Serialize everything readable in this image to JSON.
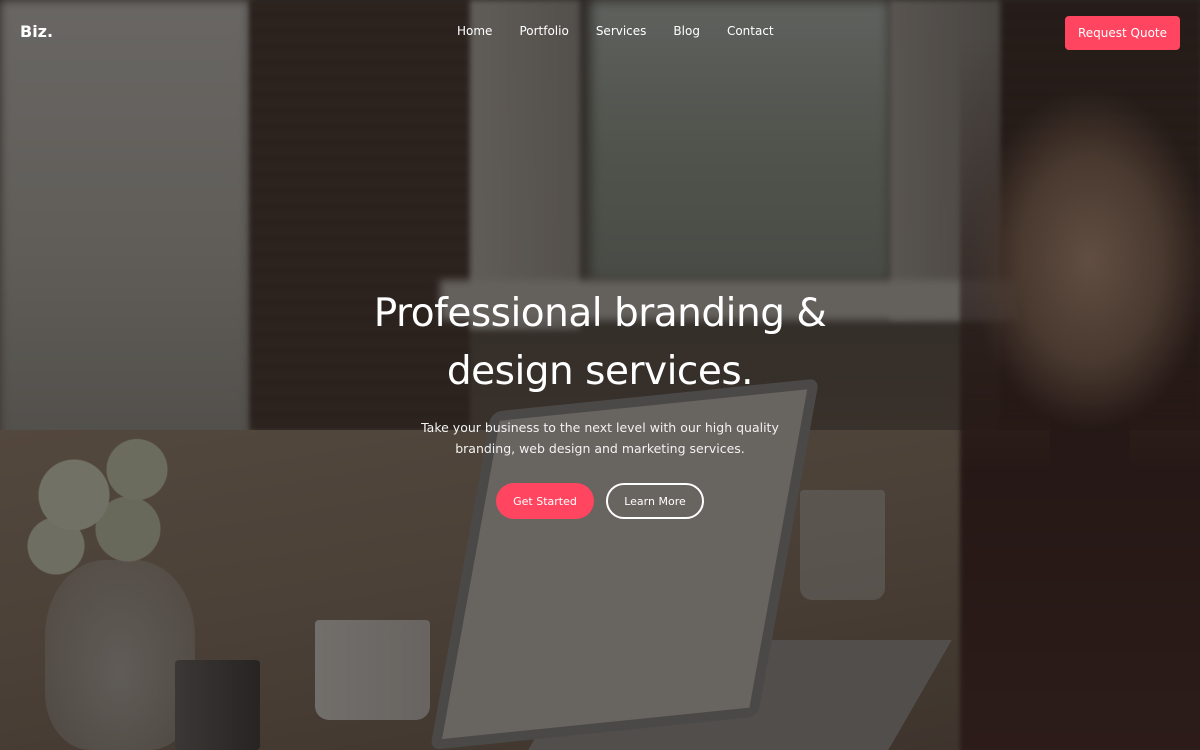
{
  "brand": {
    "logo_text": "Biz."
  },
  "nav": {
    "items": [
      {
        "label": "Home"
      },
      {
        "label": "Portfolio"
      },
      {
        "label": "Services"
      },
      {
        "label": "Blog"
      },
      {
        "label": "Contact"
      }
    ],
    "cta_label": "Request Quote"
  },
  "hero": {
    "title": "Professional branding & design services.",
    "subtitle": "Take your business to the next level with our high quality branding, web design and marketing services.",
    "primary_button": "Get Started",
    "secondary_button": "Learn More"
  },
  "colors": {
    "accent": "#ff4560",
    "text": "#ffffff"
  }
}
